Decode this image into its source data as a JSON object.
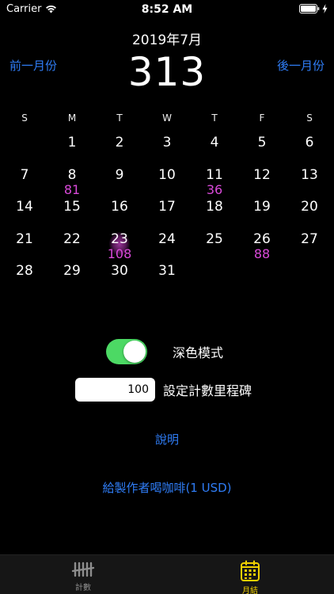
{
  "status": {
    "carrier": "Carrier",
    "time": "8:52 AM"
  },
  "header": {
    "month": "2019年7月",
    "prev": "前一月份",
    "next": "後一月份",
    "total": "313"
  },
  "weekdays": [
    "S",
    "M",
    "T",
    "W",
    "T",
    "F",
    "S"
  ],
  "calendar": {
    "days": [
      {
        "day": "",
        "count": ""
      },
      {
        "day": "1",
        "count": ""
      },
      {
        "day": "2",
        "count": ""
      },
      {
        "day": "3",
        "count": ""
      },
      {
        "day": "4",
        "count": ""
      },
      {
        "day": "5",
        "count": ""
      },
      {
        "day": "6",
        "count": ""
      },
      {
        "day": "7",
        "count": ""
      },
      {
        "day": "8",
        "count": "81"
      },
      {
        "day": "9",
        "count": ""
      },
      {
        "day": "10",
        "count": ""
      },
      {
        "day": "11",
        "count": "36"
      },
      {
        "day": "12",
        "count": ""
      },
      {
        "day": "13",
        "count": ""
      },
      {
        "day": "14",
        "count": ""
      },
      {
        "day": "15",
        "count": ""
      },
      {
        "day": "16",
        "count": ""
      },
      {
        "day": "17",
        "count": ""
      },
      {
        "day": "18",
        "count": ""
      },
      {
        "day": "19",
        "count": ""
      },
      {
        "day": "20",
        "count": ""
      },
      {
        "day": "21",
        "count": ""
      },
      {
        "day": "22",
        "count": ""
      },
      {
        "day": "23",
        "count": "108",
        "today": true
      },
      {
        "day": "24",
        "count": ""
      },
      {
        "day": "25",
        "count": ""
      },
      {
        "day": "26",
        "count": "88"
      },
      {
        "day": "27",
        "count": ""
      },
      {
        "day": "28",
        "count": ""
      },
      {
        "day": "29",
        "count": ""
      },
      {
        "day": "30",
        "count": ""
      },
      {
        "day": "31",
        "count": ""
      }
    ]
  },
  "settings": {
    "dark_mode_label": "深色模式",
    "dark_mode_on": true,
    "milestone_value": "100",
    "milestone_label": "設定計數里程碑",
    "help": "說明",
    "coffee": "給製作者喝咖啡(1 USD)"
  },
  "tabs": {
    "counter": "計數",
    "monthly": "月結"
  },
  "colors": {
    "accent": "#2f7df6",
    "count": "#d94ad9",
    "switch_on": "#4cd964",
    "tab_active": "#f0d000"
  }
}
